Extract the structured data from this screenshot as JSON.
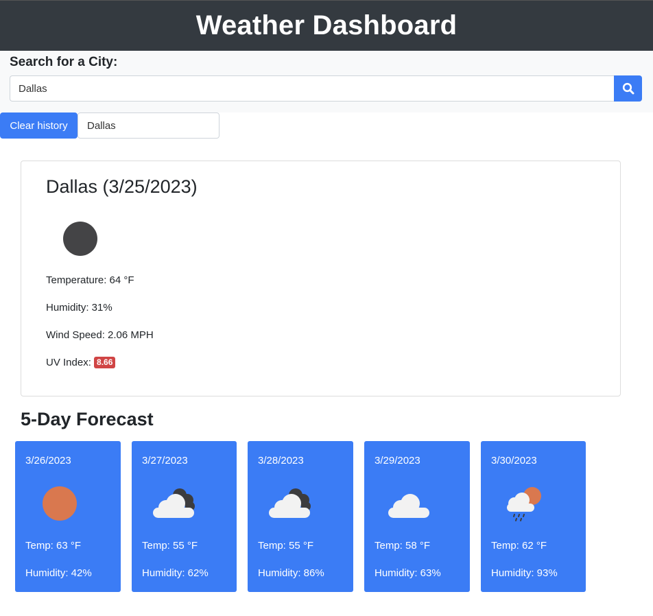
{
  "header": {
    "title": "Weather Dashboard"
  },
  "search": {
    "label": "Search for a City:",
    "value": "Dallas",
    "button_icon": "search-icon"
  },
  "history": {
    "clear_label": "Clear history",
    "items": [
      "Dallas"
    ]
  },
  "current": {
    "title": "Dallas (3/25/2023)",
    "icon": "dark-circle-icon",
    "temperature": "Temperature: 64 °F",
    "humidity": "Humidity: 31%",
    "wind": "Wind Speed: 2.06 MPH",
    "uv_label": "UV Index: ",
    "uv_value": "8.66",
    "uv_color": "#d04545"
  },
  "forecast": {
    "heading": "5-Day Forecast",
    "card_color": "#3b7cf5",
    "days": [
      {
        "date": "3/26/2023",
        "icon": "sun-icon",
        "temp": "Temp: 63 °F",
        "humidity": "Humidity: 42%"
      },
      {
        "date": "3/27/2023",
        "icon": "broken-clouds-icon",
        "temp": "Temp: 55 °F",
        "humidity": "Humidity: 62%"
      },
      {
        "date": "3/28/2023",
        "icon": "broken-clouds-icon",
        "temp": "Temp: 55 °F",
        "humidity": "Humidity: 86%"
      },
      {
        "date": "3/29/2023",
        "icon": "cloud-icon",
        "temp": "Temp: 58 °F",
        "humidity": "Humidity: 63%"
      },
      {
        "date": "3/30/2023",
        "icon": "rain-sun-icon",
        "temp": "Temp: 62 °F",
        "humidity": "Humidity: 93%"
      }
    ]
  }
}
